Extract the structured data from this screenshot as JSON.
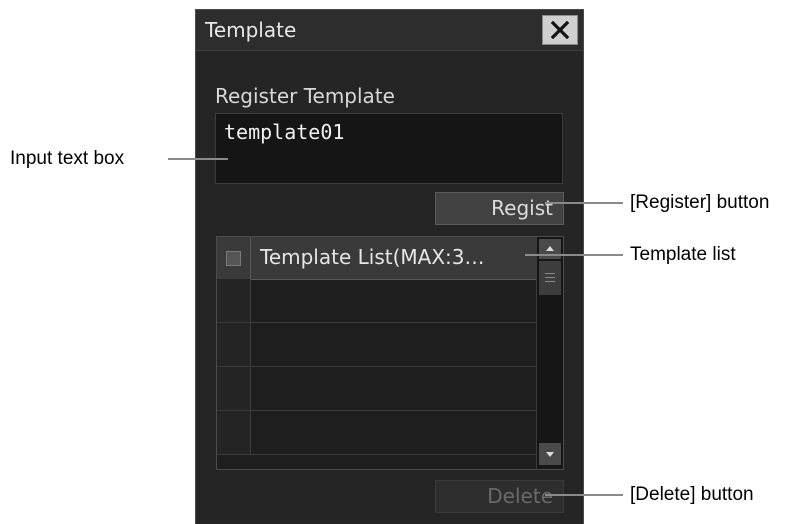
{
  "dialog": {
    "title": "Template",
    "close_icon": "close-icon",
    "section_label": "Register Template",
    "input_value": "template01",
    "regist_label": "Regist",
    "delete_label": "Delete",
    "list": {
      "header_title": "Template List(MAX:3…",
      "rows": [
        "",
        "",
        "",
        ""
      ]
    }
  },
  "callouts": {
    "input_text_box": "Input text box",
    "register_button": "[Register] button",
    "template_list": "Template list",
    "delete_button": "[Delete] button"
  },
  "colors": {
    "dialog_bg": "#252525",
    "callout_line": "#8a8a8a"
  }
}
